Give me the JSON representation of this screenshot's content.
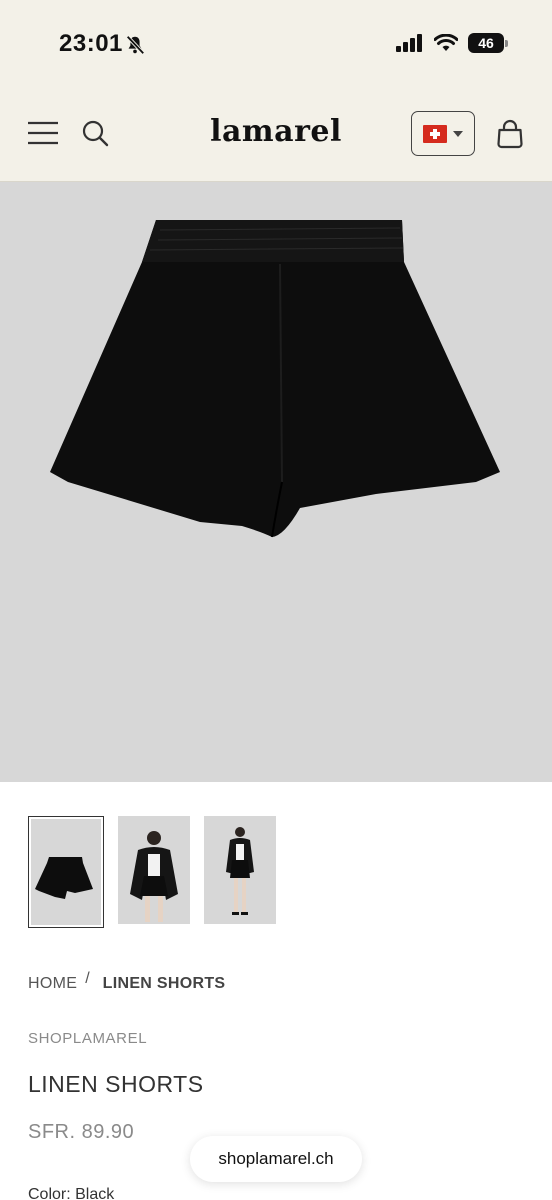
{
  "status_bar": {
    "time": "23:01",
    "battery": "46",
    "icons": [
      "bell-off-icon",
      "signal-icon",
      "wifi-icon",
      "battery-icon"
    ]
  },
  "header": {
    "logo": "lamarel",
    "country_flag": "switzerland-flag-icon",
    "icons": [
      "menu-icon",
      "search-icon",
      "chevron-down-icon",
      "shopping-bag-icon"
    ]
  },
  "gallery": {
    "main_image": "black-linen-shorts-product-photo",
    "thumbnails": [
      {
        "label": "black-linen-shorts-flatlay",
        "selected": true
      },
      {
        "label": "model-wearing-shorts-front",
        "selected": false
      },
      {
        "label": "model-wearing-shorts-full",
        "selected": false
      }
    ]
  },
  "breadcrumb": {
    "home": "HOME",
    "separator": "/",
    "current": "LINEN SHORTS"
  },
  "product": {
    "vendor": "SHOPLAMAREL",
    "title": "LINEN SHORTS",
    "price": "SFR. 89.90",
    "color_label": "Color: Black"
  },
  "browser": {
    "url": "shoplamarel.ch"
  },
  "colors": {
    "header_bg": "#f3f1e8",
    "image_bg": "#d7d7d7",
    "flag_red": "#d52b1e"
  }
}
